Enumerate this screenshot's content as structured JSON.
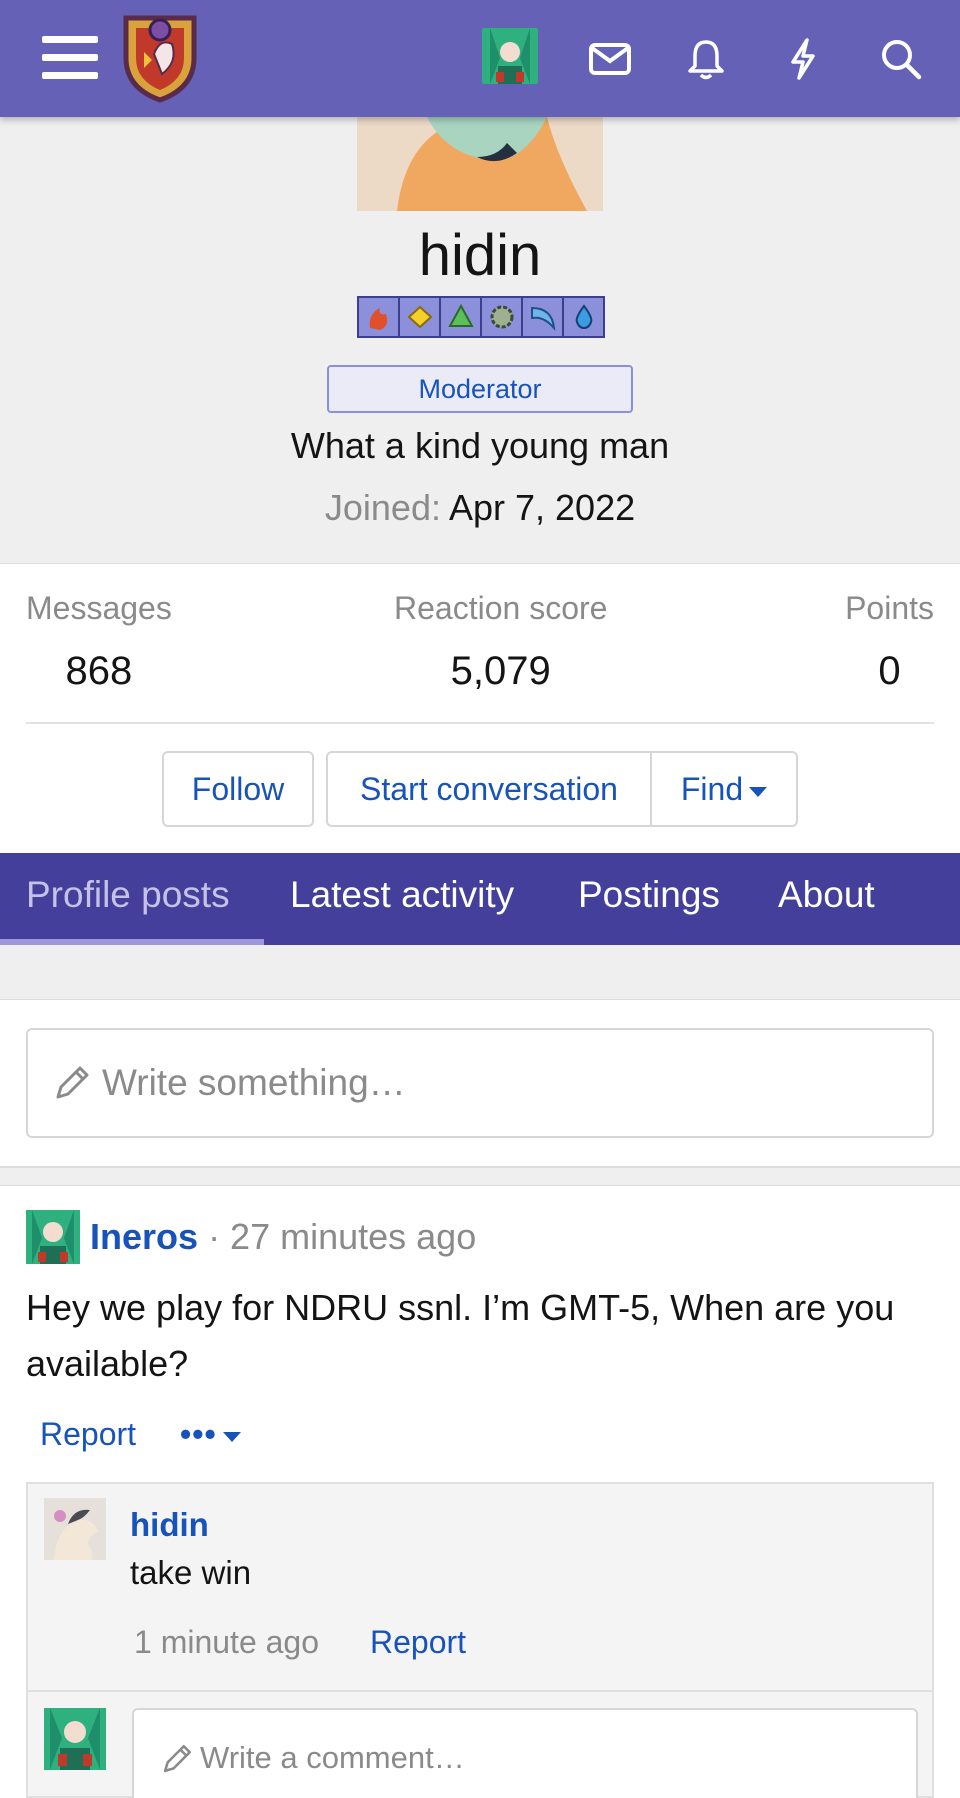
{
  "nav": {
    "icons": [
      "menu-icon",
      "site-logo",
      "user-avatar",
      "envelope-icon",
      "bell-icon",
      "bolt-icon",
      "search-icon"
    ]
  },
  "profile": {
    "username": "hidin",
    "badge": "Moderator",
    "custom_title": "What a kind young man",
    "joined_label": "Joined:",
    "joined_value": "Apr 7, 2022"
  },
  "stats": {
    "messages_label": "Messages",
    "messages_value": "868",
    "reaction_label": "Reaction score",
    "reaction_value": "5,079",
    "points_label": "Points",
    "points_value": "0"
  },
  "actions": {
    "follow": "Follow",
    "start_conversation": "Start conversation",
    "find": "Find"
  },
  "tabs": {
    "profile_posts": "Profile posts",
    "latest_activity": "Latest activity",
    "postings": "Postings",
    "about": "About"
  },
  "composer": {
    "placeholder": "Write something…"
  },
  "post": {
    "author": "Ineros",
    "time": "· 27 minutes ago",
    "body": "Hey we play for NDRU ssnl. I’m GMT-5, When are you available?",
    "report": "Report",
    "more": "•••"
  },
  "comment": {
    "author": "hidin",
    "text": "take win",
    "time": "1 minute ago",
    "report": "Report",
    "reply_placeholder": "Write a comment…"
  },
  "colors": {
    "nav_bg": "#6461b6",
    "tabs_bg": "#433f9a",
    "link": "#1753b8"
  }
}
